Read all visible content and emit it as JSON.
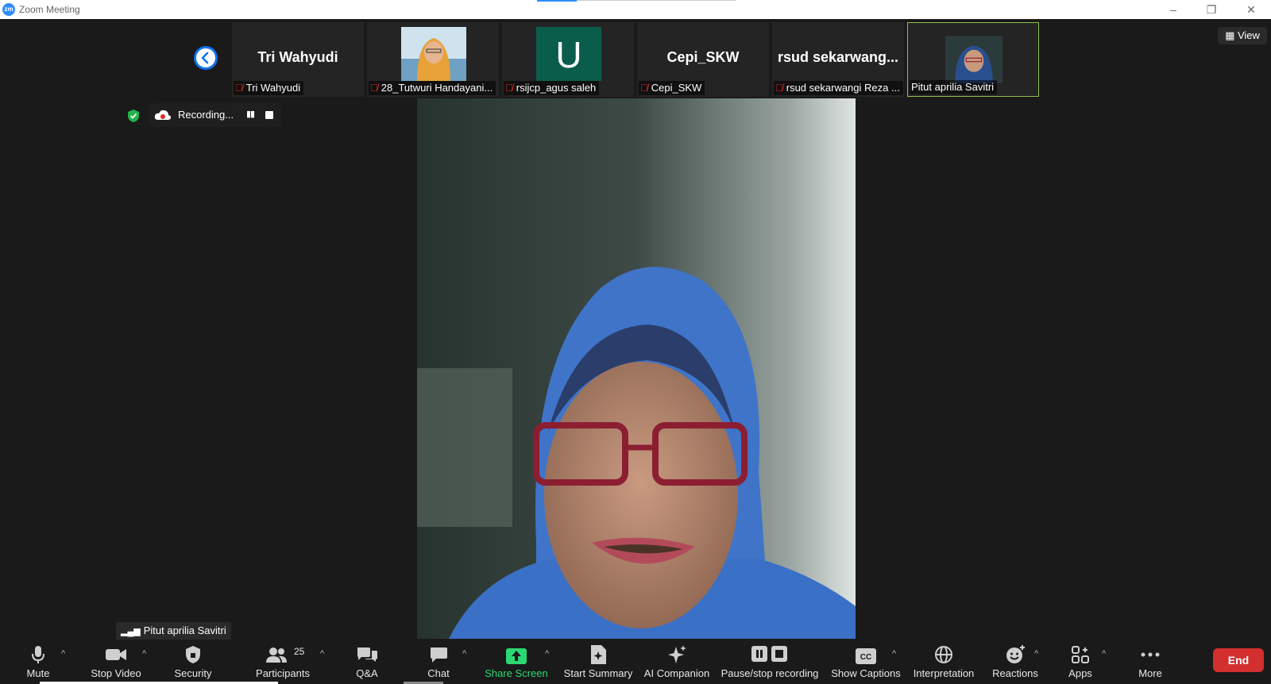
{
  "window": {
    "title": "Zoom Meeting",
    "logo_text": "zm"
  },
  "thumbnails": [
    {
      "big_name": "Tri Wahyudi",
      "label": "Tri Wahyudi",
      "muted": true,
      "type": "name"
    },
    {
      "big_name": "",
      "label": "28_Tutwuri Handayani...",
      "muted": true,
      "type": "photo"
    },
    {
      "big_name": "U",
      "label": "rsijcp_agus saleh",
      "muted": true,
      "type": "avatar"
    },
    {
      "big_name": "Cepi_SKW",
      "label": "Cepi_SKW",
      "muted": true,
      "type": "name"
    },
    {
      "big_name": "rsud  sekarwang...",
      "label": "rsud sekarwangi Reza ...",
      "muted": true,
      "type": "name"
    },
    {
      "big_name": "",
      "label": "Pitut aprilia Savitri",
      "muted": false,
      "type": "photo",
      "active": true
    }
  ],
  "view_button": {
    "label": "View"
  },
  "recording": {
    "label": "Recording..."
  },
  "active_speaker": {
    "name": "Pitut aprilia Savitri"
  },
  "toolbar": {
    "mute": "Mute",
    "stop_video": "Stop Video",
    "security": "Security",
    "participants": "Participants",
    "participants_count": "25",
    "qa": "Q&A",
    "chat": "Chat",
    "share_screen": "Share Screen",
    "start_summary": "Start Summary",
    "ai_companion": "AI Companion",
    "pause_stop_recording": "Pause/stop recording",
    "show_captions": "Show Captions",
    "interpretation": "Interpretation",
    "reactions": "Reactions",
    "apps": "Apps",
    "more": "More",
    "end": "End"
  },
  "colors": {
    "accent": "#0e72ed",
    "share_green": "#2bd873",
    "end_red": "#d32f2f",
    "muted_red": "#e02828",
    "active_border": "#8bc34a"
  }
}
